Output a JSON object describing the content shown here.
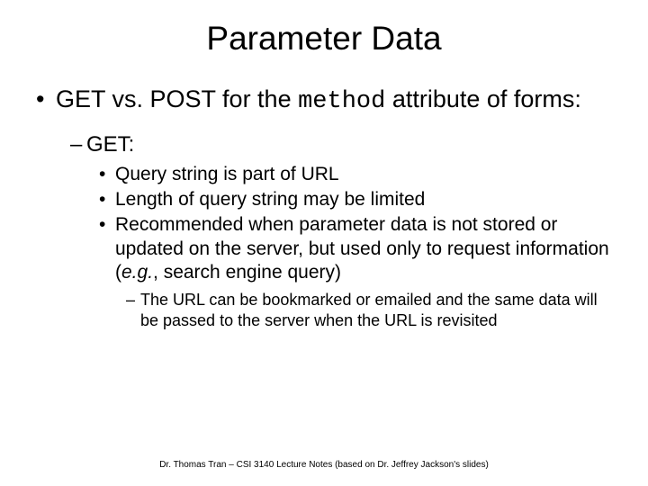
{
  "title": "Parameter Data",
  "bullet1_a": "GET vs. POST for the ",
  "bullet1_code": "method",
  "bullet1_b": " attribute of forms:",
  "sub1": "GET:",
  "points": [
    "Query string is part of URL",
    "Length of query string may be limited"
  ],
  "point3_a": "Recommended when parameter data is not stored or updated on the server, but used only to request information (",
  "point3_eg": "e.g.",
  "point3_b": ", search engine query)",
  "sub2": "The URL can be bookmarked or emailed and the same data will be passed to the server when the URL is revisited",
  "footer": "Dr. Thomas Tran – CSI 3140 Lecture Notes (based on Dr. Jeffrey Jackson's slides)"
}
